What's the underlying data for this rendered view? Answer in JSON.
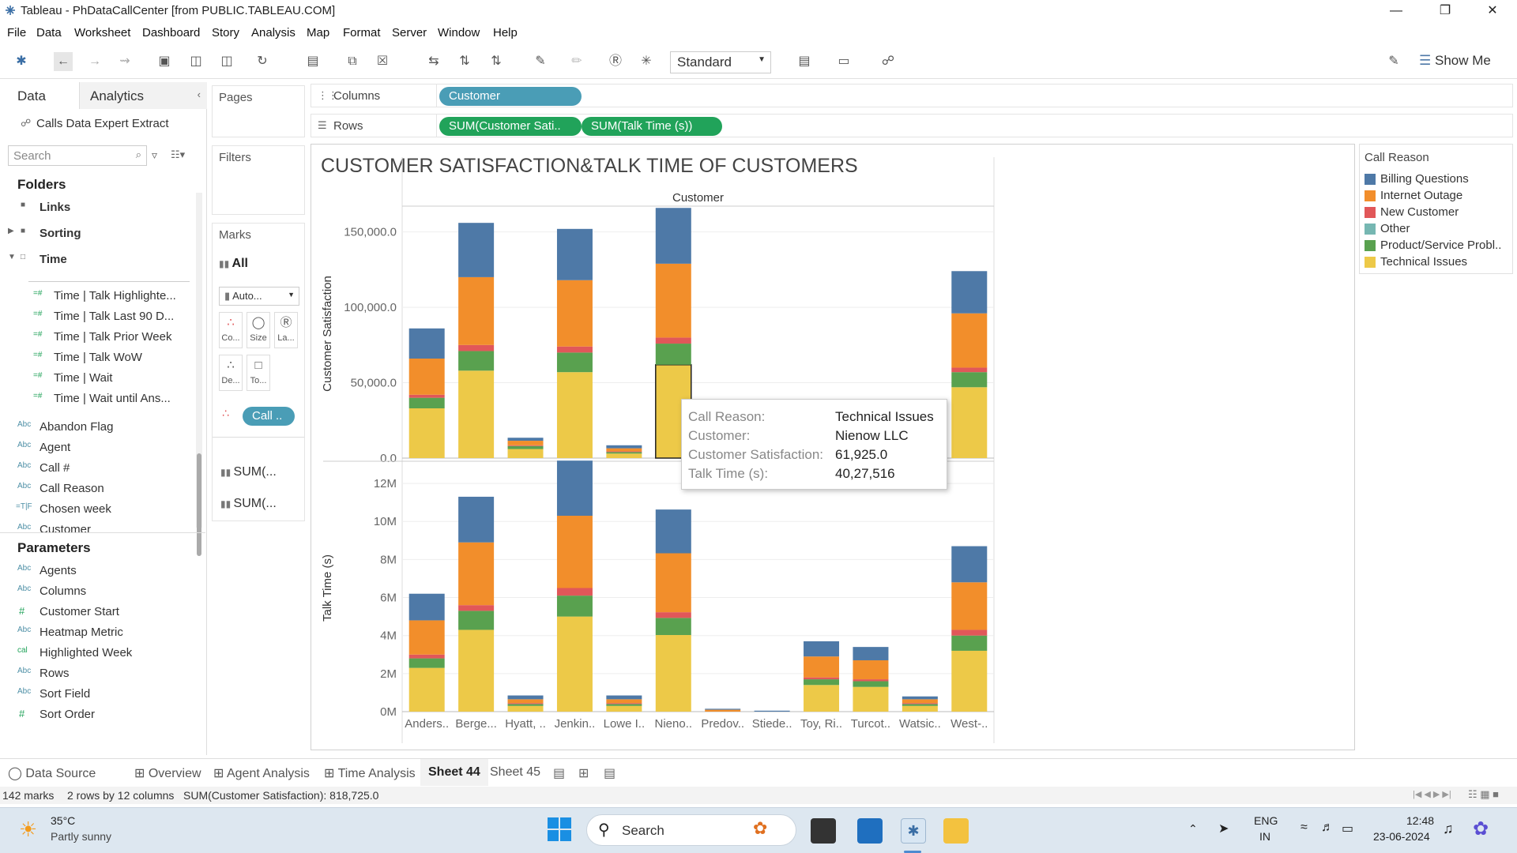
{
  "window": {
    "title": "Tableau - PhDataCallCenter [from PUBLIC.TABLEAU.COM]"
  },
  "menu": [
    "File",
    "Data",
    "Worksheet",
    "Dashboard",
    "Story",
    "Analysis",
    "Map",
    "Format",
    "Server",
    "Window",
    "Help"
  ],
  "toolbar": {
    "fit_label": "Standard",
    "show_me_label": "Show Me"
  },
  "datapane": {
    "tabs": [
      "Data",
      "Analytics"
    ],
    "datasource": "Calls Data Expert Extract",
    "search_placeholder": "Search",
    "folders_header": "Folders",
    "folders": [
      "Links",
      "Sorting",
      "Time"
    ],
    "time_fields": [
      "Time | Talk Highlighte...",
      "Time | Talk Last 90 D...",
      "Time | Talk Prior Week",
      "Time | Talk WoW",
      "Time | Wait",
      "Time | Wait until Ans..."
    ],
    "fields": [
      "Abandon Flag",
      "Agent",
      "Call #",
      "Call Reason",
      "Chosen week",
      "Customer"
    ],
    "field_icons": [
      "Abc",
      "Abc",
      "Abc",
      "Abc",
      "=T|F",
      "Abc"
    ],
    "parameters_header": "Parameters",
    "parameters": [
      "Agents",
      "Columns",
      "Customer Start",
      "Heatmap Metric",
      "Highlighted Week",
      "Rows",
      "Sort Field",
      "Sort Order"
    ],
    "parameter_icons": [
      "Abc",
      "Abc",
      "#",
      "Abc",
      "cal",
      "Abc",
      "Abc",
      "#"
    ]
  },
  "shelves": {
    "pages_label": "Pages",
    "filters_label": "Filters",
    "columns_label": "Columns",
    "rows_label": "Rows",
    "columns_pill": "Customer",
    "rows_pills": [
      "SUM(Customer Sati..",
      "SUM(Talk Time (s))"
    ]
  },
  "marks": {
    "title": "Marks",
    "all_label": "All",
    "type": "Auto...",
    "buttons": [
      "Co...",
      "Size",
      "La...",
      "De...",
      "To..."
    ],
    "color_pill": "Call ..",
    "measure_cards": [
      "SUM(...",
      "SUM(..."
    ]
  },
  "legend": {
    "title": "Call Reason",
    "items": [
      {
        "label": "Billing Questions",
        "color": "#4e79a7"
      },
      {
        "label": "Internet Outage",
        "color": "#f28e2b"
      },
      {
        "label": "New Customer",
        "color": "#e15759"
      },
      {
        "label": "Other",
        "color": "#76b7b2"
      },
      {
        "label": "Product/Service Probl..",
        "color": "#59a14f"
      },
      {
        "label": "Technical Issues",
        "color": "#edc948"
      }
    ]
  },
  "tooltip": {
    "rows": [
      {
        "k": "Call Reason:",
        "v": "Technical Issues"
      },
      {
        "k": "Customer:",
        "v": "Nienow LLC"
      },
      {
        "k": "Customer Satisfaction:",
        "v": "61,925.0"
      },
      {
        "k": "Talk Time (s):",
        "v": "40,27,516"
      }
    ]
  },
  "chart_data": {
    "type": "bar",
    "stacked": true,
    "title": "CUSTOMER SATISFACTION&TALK TIME OF CUSTOMERS",
    "column_header": "Customer",
    "categories": [
      "Anders..",
      "Berge...",
      "Hyatt, ..",
      "Jenkin..",
      "Lowe I..",
      "Nieno..",
      "Predov..",
      "Stiede..",
      "Toy, Ri..",
      "Turcot..",
      "Watsic..",
      "West-.."
    ],
    "panes": [
      {
        "ylabel": "Customer Satisfaction",
        "ylim": [
          0,
          165000
        ],
        "ticks": [
          0,
          50000,
          100000,
          150000
        ],
        "tick_labels": [
          "0.0",
          "50,000.0",
          "100,000.0",
          "150,000.0"
        ],
        "series": [
          {
            "name": "Technical Issues",
            "values": [
              33000,
              58000,
              6000,
              57000,
              3000,
              61925,
              0,
              0,
              0,
              0,
              0,
              47000
            ]
          },
          {
            "name": "Product/Service Probl..",
            "values": [
              7000,
              13000,
              2000,
              13000,
              1000,
              14000,
              0,
              0,
              0,
              0,
              0,
              10000
            ]
          },
          {
            "name": "Other",
            "values": [
              0,
              0,
              0,
              0,
              0,
              0,
              0,
              0,
              0,
              0,
              0,
              0
            ]
          },
          {
            "name": "New Customer",
            "values": [
              2000,
              4000,
              500,
              4000,
              500,
              4000,
              0,
              0,
              0,
              0,
              0,
              3000
            ]
          },
          {
            "name": "Internet Outage",
            "values": [
              24000,
              45000,
              3000,
              44000,
              2000,
              49000,
              0,
              0,
              0,
              0,
              0,
              36000
            ]
          },
          {
            "name": "Billing Questions",
            "values": [
              20000,
              36000,
              2000,
              34000,
              2000,
              37000,
              0,
              0,
              0,
              0,
              0,
              28000
            ]
          }
        ]
      },
      {
        "ylabel": "Talk Time (s)",
        "ylim": [
          0,
          13000000
        ],
        "ticks": [
          0,
          2000000,
          4000000,
          6000000,
          8000000,
          10000000,
          12000000
        ],
        "tick_labels": [
          "0M",
          "2M",
          "4M",
          "6M",
          "8M",
          "10M",
          "12M"
        ],
        "series": [
          {
            "name": "Technical Issues",
            "values": [
              2300000,
              4300000,
              300000,
              5000000,
              300000,
              4027516,
              0,
              0,
              1400000,
              1300000,
              300000,
              3200000
            ]
          },
          {
            "name": "Product/Service Probl..",
            "values": [
              500000,
              1000000,
              100000,
              1100000,
              100000,
              900000,
              0,
              0,
              300000,
              300000,
              100000,
              800000
            ]
          },
          {
            "name": "Other",
            "values": [
              0,
              0,
              0,
              0,
              0,
              0,
              0,
              0,
              0,
              0,
              0,
              0
            ]
          },
          {
            "name": "New Customer",
            "values": [
              200000,
              300000,
              50000,
              400000,
              50000,
              300000,
              0,
              0,
              100000,
              100000,
              50000,
              300000
            ]
          },
          {
            "name": "Internet Outage",
            "values": [
              1800000,
              3300000,
              200000,
              3800000,
              200000,
              3100000,
              100000,
              0,
              1100000,
              1000000,
              200000,
              2500000
            ]
          },
          {
            "name": "Billing Questions",
            "values": [
              1400000,
              2400000,
              200000,
              2900000,
              200000,
              2300000,
              50000,
              50000,
              800000,
              700000,
              150000,
              1900000
            ]
          }
        ]
      }
    ]
  },
  "sheets": {
    "tabs": [
      "Data Source",
      "Overview",
      "Agent Analysis",
      "Time Analysis",
      "Sheet 44",
      "Sheet 45"
    ],
    "active": "Sheet 44"
  },
  "status": {
    "marks": "142 marks",
    "dims": "2 rows by 12 columns",
    "sum": "SUM(Customer Satisfaction): 818,725.0"
  },
  "taskbar": {
    "weather_temp": "35°C",
    "weather_desc": "Partly sunny",
    "search_label": "Search",
    "lang1": "ENG",
    "lang2": "IN",
    "time": "12:48",
    "date": "23-06-2024"
  }
}
